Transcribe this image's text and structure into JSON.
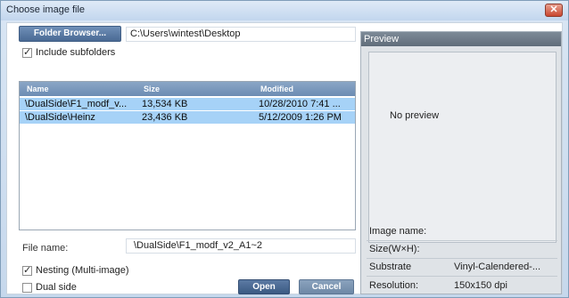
{
  "window": {
    "title": "Choose image file",
    "close_glyph": "✕"
  },
  "folder": {
    "browse_label": "Folder Browser...",
    "path": "C:\\Users\\wintest\\Desktop"
  },
  "include_subfolders": {
    "label": "Include subfolders",
    "checked": true
  },
  "file_list": {
    "columns": [
      "Name",
      "Size",
      "Modified"
    ],
    "rows": [
      {
        "name": "\\DualSide\\F1_modf_v...",
        "size": "13,534 KB",
        "modified": "10/28/2010 7:41 ...",
        "selected": true
      },
      {
        "name": "\\DualSide\\Heinz",
        "size": "23,436 KB",
        "modified": "5/12/2009 1:26 PM",
        "selected": true
      }
    ]
  },
  "file_name": {
    "label": "File name:",
    "value": "\\DualSide\\F1_modf_v2_A1~2"
  },
  "nesting": {
    "label": "Nesting (Multi-image)",
    "checked": true
  },
  "dual_side": {
    "label": "Dual side",
    "checked": false
  },
  "buttons": {
    "open": "Open",
    "cancel": "Cancel"
  },
  "preview": {
    "header": "Preview",
    "empty_text": "No preview",
    "image_name_label": "Image name:",
    "size_label": "Size(W×H):",
    "substrate_label": "Substrate",
    "substrate_value": "Vinyl-Calendered-...",
    "resolution_label": "Resolution:",
    "resolution_value": "150x150 dpi"
  },
  "colors": {
    "selection": "#a6d2f7",
    "header_blue": "#6c8cb3",
    "preview_header": "#5f6c79"
  },
  "icons": {
    "close": "close-icon",
    "check": "check-icon"
  }
}
